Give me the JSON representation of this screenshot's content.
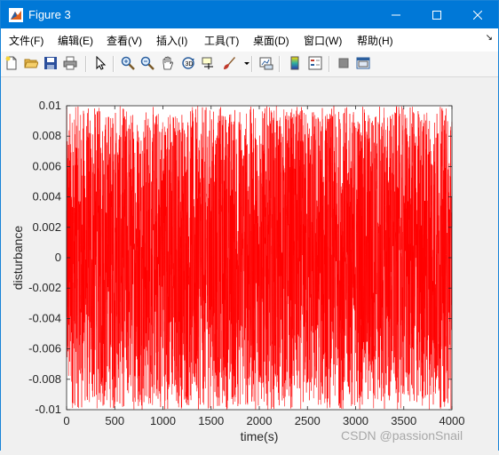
{
  "window": {
    "title": "Figure 3",
    "controls": [
      "minimize",
      "maximize",
      "close"
    ]
  },
  "menubar": {
    "items": [
      {
        "label": "文件(F)"
      },
      {
        "label": "编辑(E)"
      },
      {
        "label": "查看(V)"
      },
      {
        "label": "插入(I)"
      },
      {
        "label": "工具(T)"
      },
      {
        "label": "桌面(D)"
      },
      {
        "label": "窗口(W)"
      },
      {
        "label": "帮助(H)"
      }
    ],
    "overflow_icon": "chevron-icon"
  },
  "toolbar": {
    "icons": [
      "new-figure-icon",
      "open-file-icon",
      "save-icon",
      "print-icon",
      "pointer-icon",
      "zoom-in-icon",
      "zoom-out-icon",
      "pan-icon",
      "rotate-3d-icon",
      "data-cursor-icon",
      "brush-icon",
      "link-plot-icon",
      "colorbar-icon",
      "legend-icon",
      "hide-plot-tools-icon",
      "show-plot-tools-icon"
    ]
  },
  "watermark": "CSDN @passionSnail",
  "colors": {
    "titlebar": "#0078d7",
    "line": "#ff0000"
  },
  "chart_data": {
    "type": "line",
    "title": "",
    "xlabel": "time(s)",
    "ylabel": "disturbance",
    "xlim": [
      0,
      4000
    ],
    "ylim": [
      -0.01,
      0.01
    ],
    "xticks": [
      0,
      500,
      1000,
      1500,
      2000,
      2500,
      3000,
      3500,
      4000
    ],
    "xtick_labels": [
      "0",
      "500",
      "1000",
      "1500",
      "2000",
      "2500",
      "3000",
      "3500",
      "4000"
    ],
    "yticks": [
      -0.01,
      -0.008,
      -0.006,
      -0.004,
      -0.002,
      0,
      0.002,
      0.004,
      0.006,
      0.008,
      0.01
    ],
    "ytick_labels": [
      "-0.01",
      "-0.008",
      "-0.006",
      "-0.004",
      "-0.002",
      "0",
      "0.002",
      "0.004",
      "0.006",
      "0.008",
      "0.01"
    ],
    "grid": false,
    "series": [
      {
        "color": "#ff0000",
        "distribution": "uniform random",
        "x_range": [
          0,
          4000
        ],
        "y_range": [
          -0.01,
          0.01
        ]
      }
    ]
  }
}
